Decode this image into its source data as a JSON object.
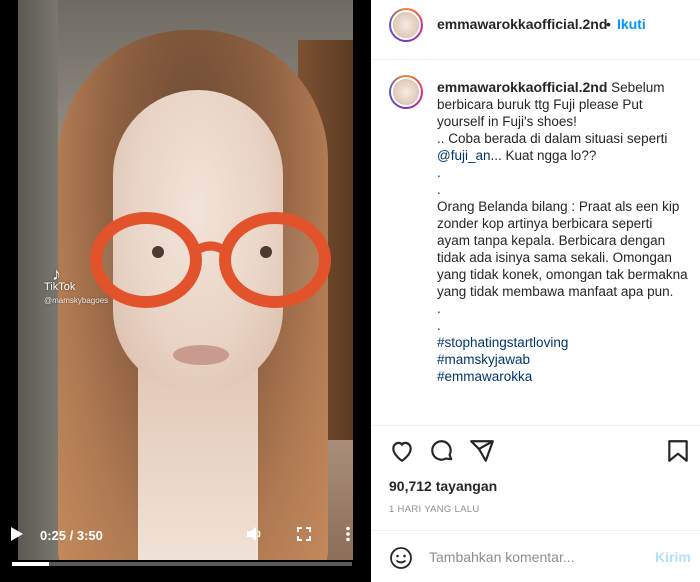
{
  "video": {
    "tiktok_logo": "TikTok",
    "tiktok_user": "@mamskybagoes",
    "time": "0:25 / 3:50",
    "progress": 0.11
  },
  "header": {
    "username": "emmawarokkaofficial.2nd",
    "separator": "•",
    "follow_label": "Ikuti"
  },
  "caption": {
    "username": "emmawarokkaofficial.2nd",
    "line1": "Sebelum berbicara buruk ttg Fuji please Put yourself in Fuji's shoes!",
    "line2_prefix": ".. Coba berada di dalam situasi seperti ",
    "mention": "@fuji_an",
    "line2_suffix": "... Kuat ngga lo??",
    "dot1": ".",
    "dot2": ".",
    "paragraph": "Orang Belanda bilang : Praat als een kip zonder kop artinya berbicara seperti ayam tanpa kepala. Berbicara dengan tidak ada isinya sama sekali. Omongan yang tidak konek, omongan tak bermakna yang tidak membawa manfaat apa pun.",
    "dot3": ".",
    "dot4": ".",
    "hashtags": [
      "#stophatingstartloving",
      "#mamskyjawab",
      "#emmawarokka"
    ]
  },
  "actions": {
    "icons": [
      "heart-icon",
      "comment-icon",
      "share-icon",
      "bookmark-icon"
    ],
    "views": "90,712 tayangan",
    "date": "1 HARI YANG LALU"
  },
  "comment": {
    "placeholder": "Tambahkan komentar...",
    "post_label": "Kirim"
  },
  "colors": {
    "link": "#0095f6",
    "mention": "#00376b",
    "post_disabled": "#b2dffc",
    "muted": "#8e8e8e"
  }
}
